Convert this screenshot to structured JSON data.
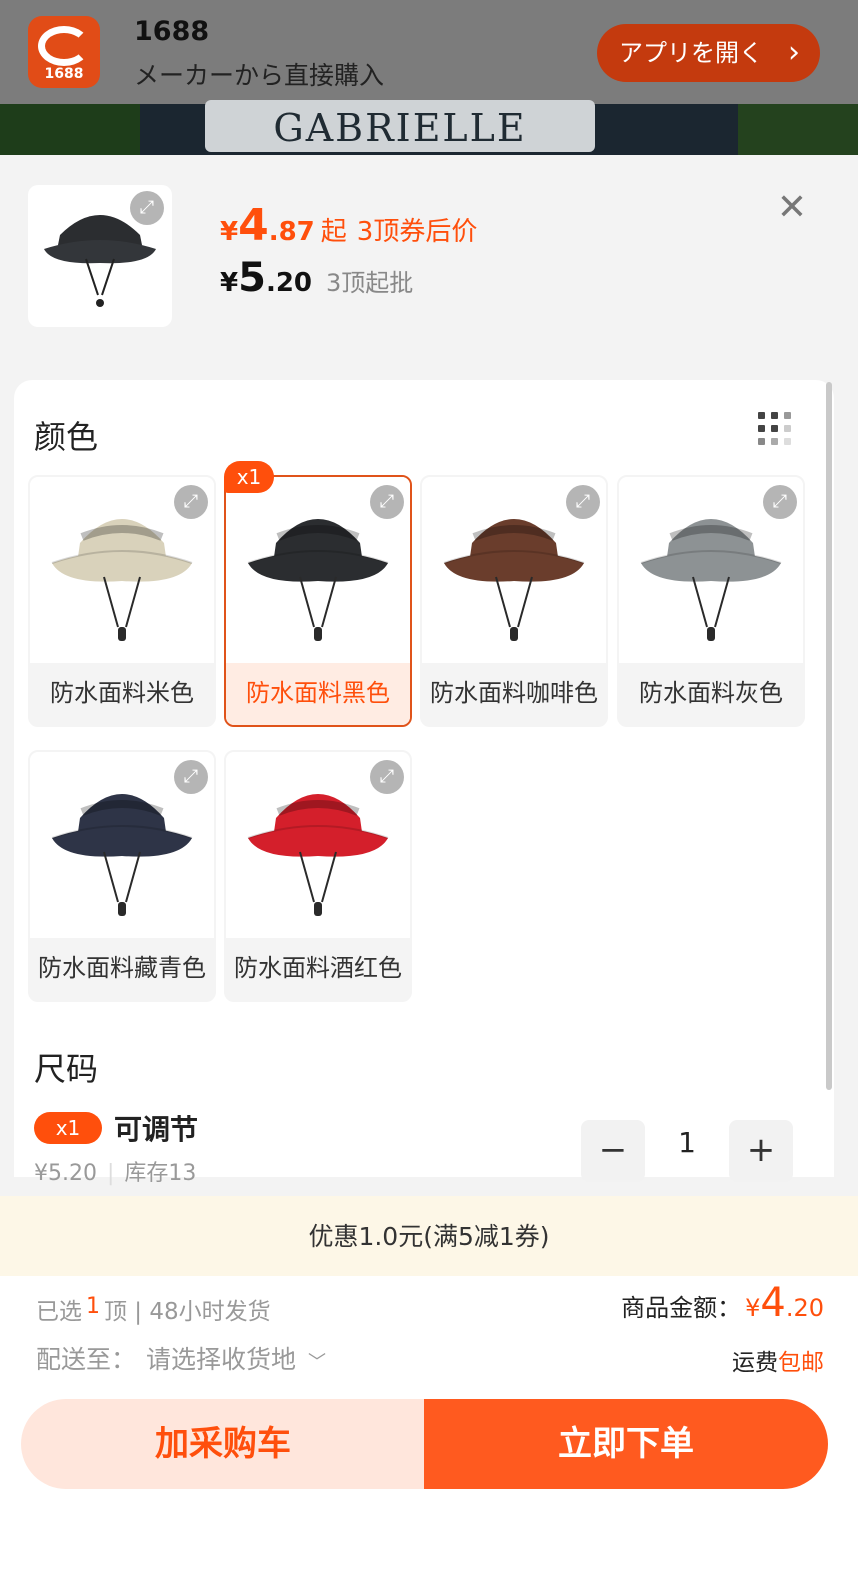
{
  "banner": {
    "app_logo_text": "1688",
    "app_name": "1688",
    "app_subtitle": "メーカーから直接購入",
    "open_app_label": "アプリを開く",
    "background_shirt_text": "GABRIELLE CHANEL"
  },
  "product": {
    "coupon_price": {
      "currency": "¥",
      "integer": "4",
      "decimal": ".87",
      "suffix": "起",
      "note": "3顶券后价"
    },
    "wholesale_price": {
      "currency": "¥",
      "integer": "5",
      "decimal": ".20",
      "moq": "3顶起批"
    }
  },
  "color_section": {
    "title": "颜色",
    "options": [
      {
        "label": "防水面料米色",
        "color": "#d9d2bb",
        "selected": false
      },
      {
        "label": "防水面料黑色",
        "color": "#2b2d30",
        "selected": true,
        "badge": "x1"
      },
      {
        "label": "防水面料咖啡色",
        "color": "#6a3d2c",
        "selected": false
      },
      {
        "label": "防水面料灰色",
        "color": "#8d9294",
        "selected": false
      },
      {
        "label": "防水面料藏青色",
        "color": "#2e3447",
        "selected": false
      },
      {
        "label": "防水面料酒红色",
        "color": "#d41f2b",
        "selected": false
      }
    ]
  },
  "size_section": {
    "title": "尺码",
    "badge": "x1",
    "name": "可调节",
    "price": "¥5.20",
    "stock": "库存13",
    "quantity": "1",
    "minus": "−",
    "plus": "+"
  },
  "promo": {
    "text": "优惠1.0元(满5减1券)"
  },
  "summary": {
    "selected_prefix": "已选",
    "selected_count": "1",
    "selected_suffix": "顶 | 48小时发货",
    "ship_label": "配送至：",
    "ship_address": "请选择收货地",
    "total_label": "商品金额：",
    "total_currency": "¥",
    "total_integer": "4",
    "total_decimal": ".20",
    "freight_label": "运费",
    "freight_value": "包邮"
  },
  "actions": {
    "add_cart": "加采购车",
    "buy_now": "立即下单"
  },
  "colors": {
    "accent": "#ff4f0c",
    "button_orange": "#ff5a1f",
    "cart_bg": "#ffe6dc",
    "promo_bg": "#fdf7e7"
  }
}
